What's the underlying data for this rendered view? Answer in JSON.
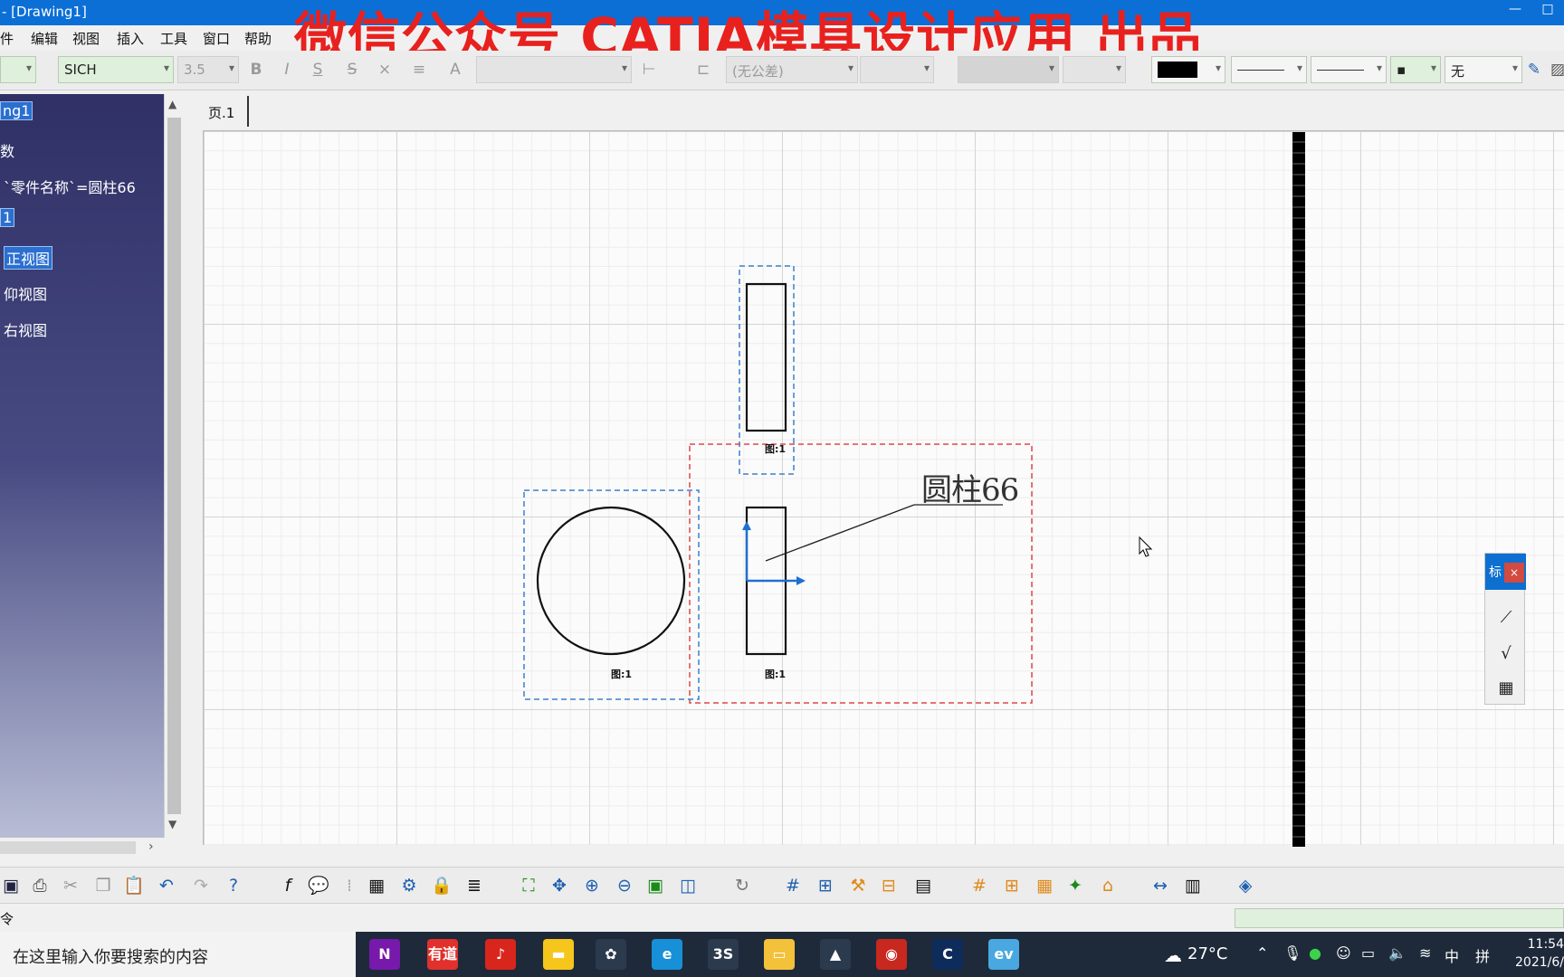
{
  "window": {
    "title": "- [Drawing1]",
    "minimize": "—",
    "maximize": "□"
  },
  "watermark": "微信公众号 CATIA模具设计应用 出品",
  "menu": [
    "件",
    "编辑",
    "视图",
    "插入",
    "工具",
    "窗口",
    "帮助"
  ],
  "properties_toolbar": {
    "font_name": "SICH",
    "font_size": "3.5",
    "tolerance": "(无公差)",
    "fill": "无",
    "line_color": "#000000"
  },
  "tree": {
    "root": "ng1",
    "items": [
      {
        "label": "数"
      },
      {
        "label": "`零件名称`=圆柱66"
      },
      {
        "label": "1",
        "selected": true
      },
      {
        "label": "正视图",
        "selected": true
      },
      {
        "label": "仰视图"
      },
      {
        "label": "右视图"
      }
    ]
  },
  "sheet_tab": "页.1",
  "drawing": {
    "annotation_text": "圆柱66",
    "view_labels": [
      "图:1",
      "图:1",
      "图:1"
    ]
  },
  "floating_toolbar": {
    "title": "标",
    "close": "×"
  },
  "status": {
    "command": "令"
  },
  "taskbar": {
    "search_placeholder": "在这里输入你要搜索的内容",
    "apps": [
      {
        "name": "onenote",
        "label": "N",
        "color": "#7719aa"
      },
      {
        "name": "youdao",
        "label": "有道",
        "color": "#e0312c"
      },
      {
        "name": "music",
        "label": "♪",
        "color": "#d9261c"
      },
      {
        "name": "sticky-notes",
        "label": "▬",
        "color": "#f6c61c"
      },
      {
        "name": "pinwheel",
        "label": "✿",
        "color": "#2c3a4d"
      },
      {
        "name": "edge",
        "label": "e",
        "color": "#1790d8"
      },
      {
        "name": "app-3s",
        "label": "3S",
        "color": "#2c3a4d"
      },
      {
        "name": "file-explorer",
        "label": "▭",
        "color": "#f3c13a"
      },
      {
        "name": "photos",
        "label": "▲",
        "color": "#2c3a4d"
      },
      {
        "name": "catia-red",
        "label": "◉",
        "color": "#c8281e"
      },
      {
        "name": "catia",
        "label": "C",
        "color": "#0d2c5c"
      },
      {
        "name": "app-ev",
        "label": "ev",
        "color": "#4aa8e0"
      }
    ],
    "weather": "27°C",
    "ime": "中",
    "ime2": "拼",
    "time": "11:54",
    "date": "2021/6/"
  },
  "colors": {
    "title_bar": "#0b6fd6",
    "watermark": "#e8211e",
    "tree_bg": "#2f3066",
    "view_frame_blue": "#3d7fd0",
    "view_frame_red": "#e04848",
    "axis": "#1f6fd0"
  }
}
